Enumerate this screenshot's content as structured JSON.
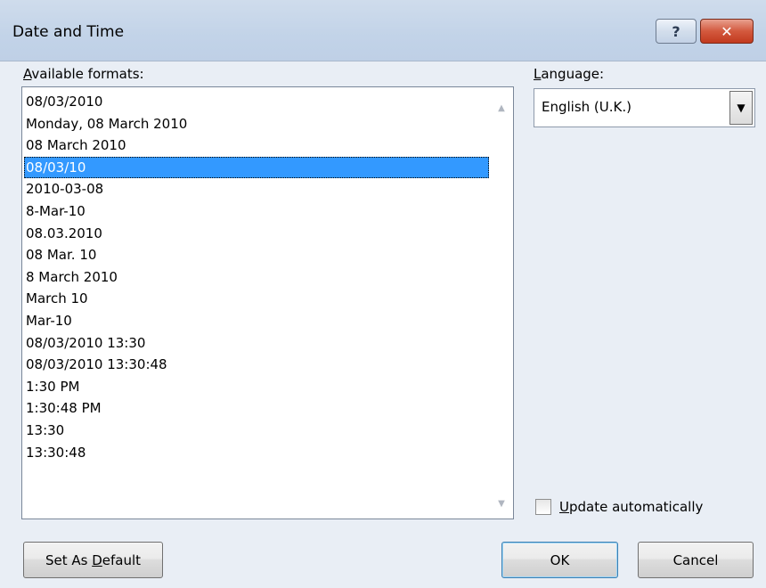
{
  "window": {
    "title": "Date and Time",
    "help_symbol": "?",
    "close_symbol": "✕"
  },
  "formats": {
    "label_key": "A",
    "label_rest": "vailable formats:",
    "items": [
      "08/03/2010",
      "Monday, 08 March 2010",
      "08 March 2010",
      "08/03/10",
      "2010-03-08",
      "8-Mar-10",
      "08.03.2010",
      "08 Mar. 10",
      "8 March 2010",
      "March 10",
      "Mar-10",
      "08/03/2010 13:30",
      "08/03/2010 13:30:48",
      "1:30 PM",
      "1:30:48 PM",
      "13:30",
      "13:30:48"
    ],
    "selected_index": 3
  },
  "language": {
    "label_key": "L",
    "label_rest": "anguage:",
    "value": "English (U.K.)"
  },
  "update": {
    "label_key": "U",
    "label_rest": "pdate automatically",
    "checked": false
  },
  "buttons": {
    "set_default_pre": "Set As ",
    "set_default_key": "D",
    "set_default_post": "efault",
    "ok": "OK",
    "cancel": "Cancel"
  },
  "colors": {
    "selection": "#3399ff",
    "titlebar": "#c2d3e8",
    "close_button": "#d3593e"
  }
}
